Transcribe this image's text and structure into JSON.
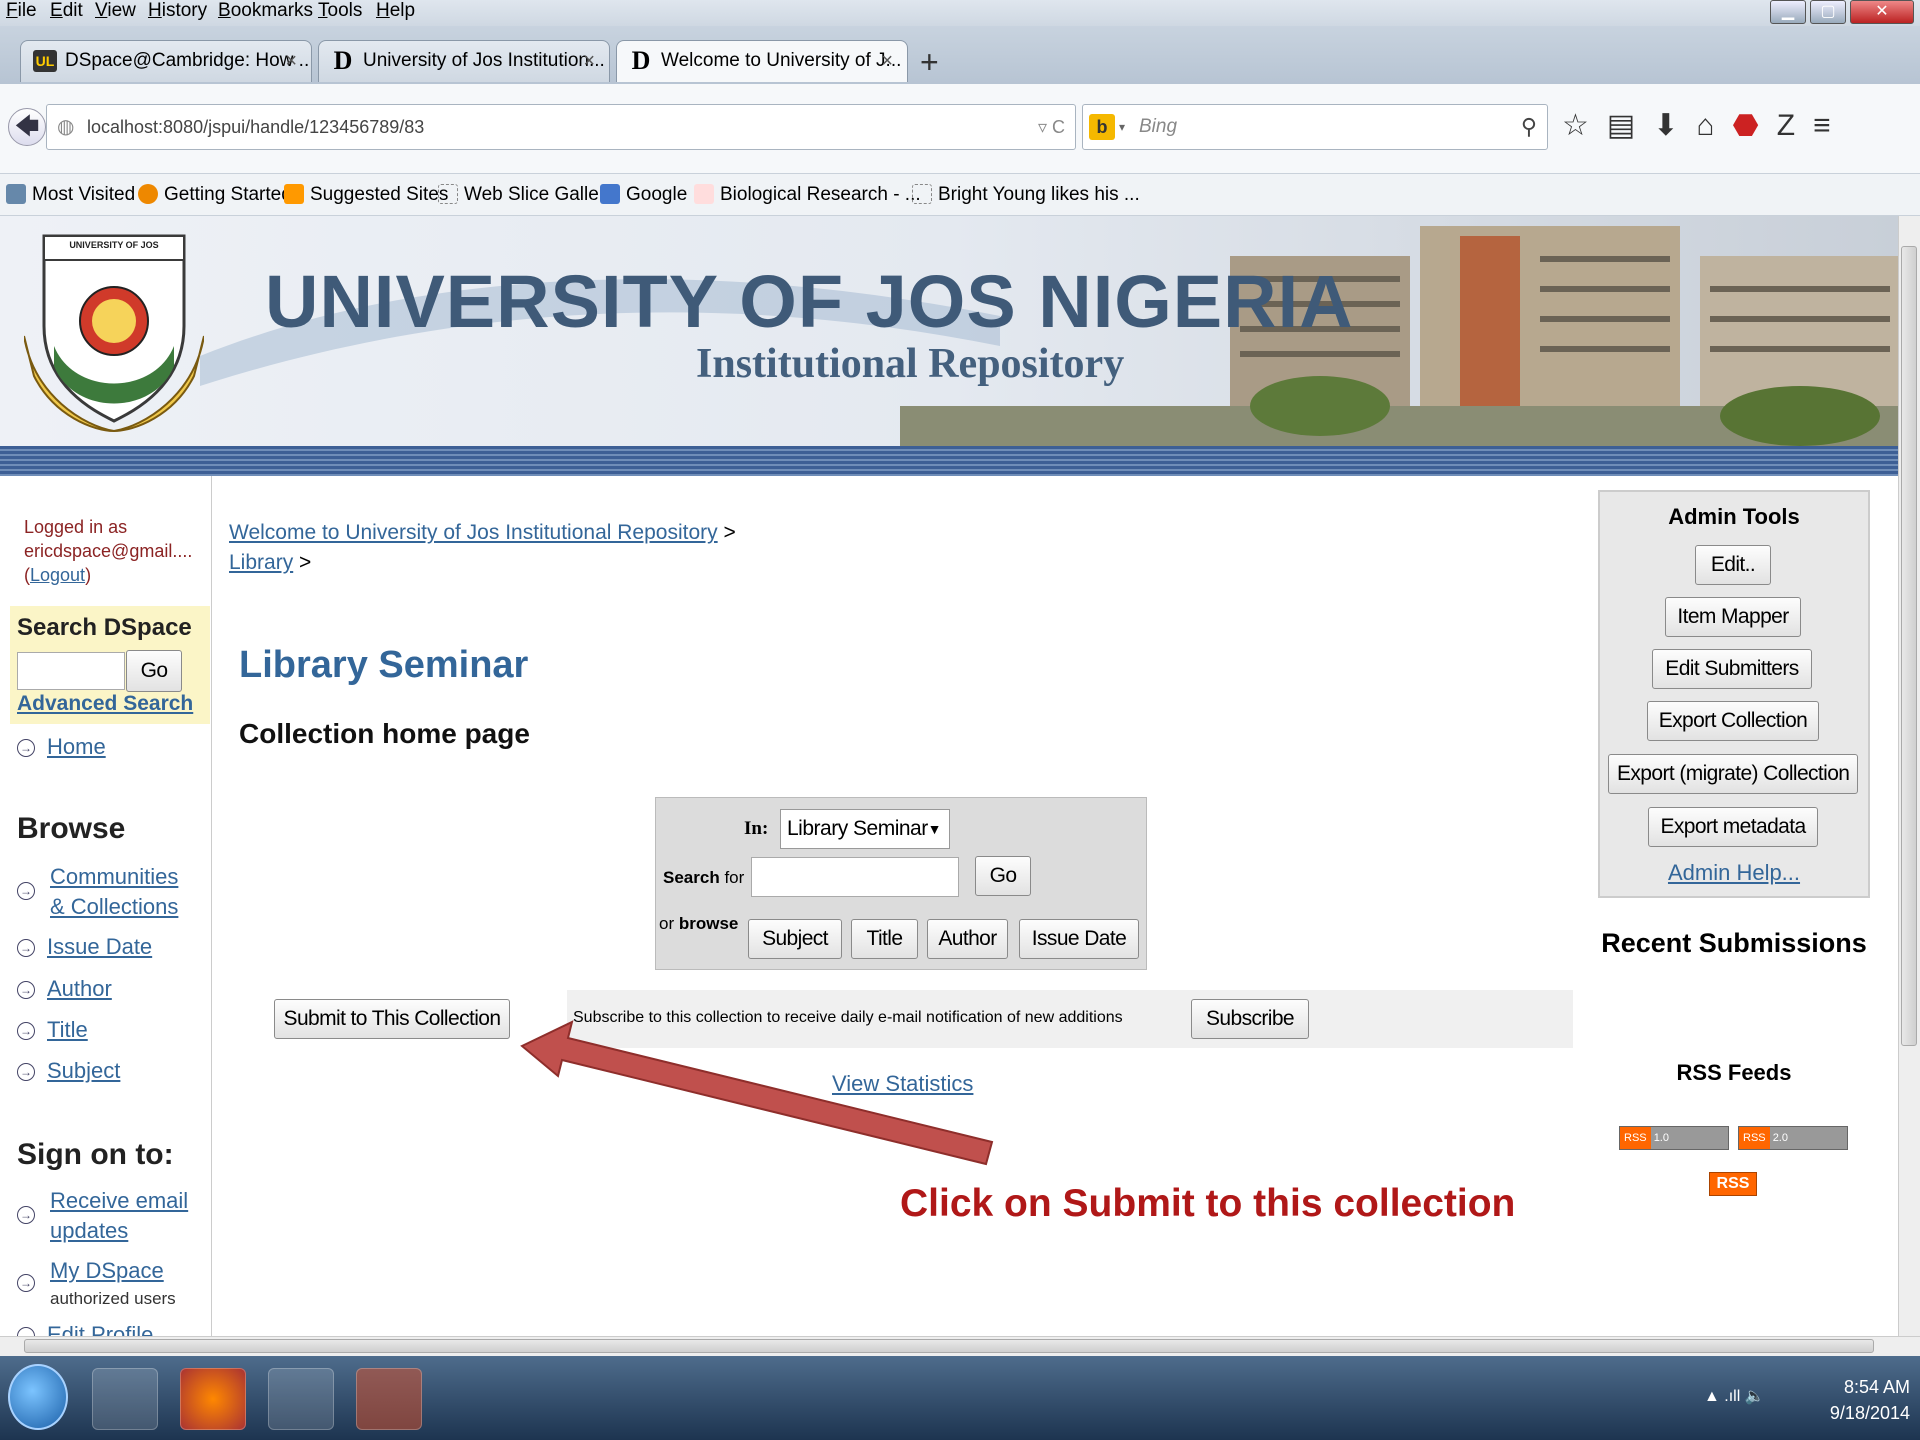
{
  "menu": [
    "File",
    "Edit",
    "View",
    "History",
    "Bookmarks",
    "Tools",
    "Help"
  ],
  "tabs": [
    {
      "icon": "UL",
      "title": "DSpace@Cambridge: How ..."
    },
    {
      "icon": "D",
      "title": "University of Jos Institution..."
    },
    {
      "icon": "D",
      "title": "Welcome to University of J..."
    }
  ],
  "new_tab": "+",
  "url": "localhost:8080/jspui/handle/123456789/83",
  "search_placeholder": "Bing",
  "bookmarks": [
    "Most Visited",
    "Getting Started",
    "Suggested Sites",
    "Web Slice Gallery",
    "Google",
    "Biological Research - ...",
    "Bright Young likes his ..."
  ],
  "banner": {
    "seal_text": "UNIVERSITY OF JOS",
    "title": "UNIVERSITY OF JOS NIGERIA",
    "subtitle": "Institutional Repository"
  },
  "left": {
    "logged_in_label": "Logged in as",
    "user": "ericdspace@gmail....",
    "logout": "Logout",
    "search_heading": "Search DSpace",
    "go": "Go",
    "advanced": "Advanced Search",
    "home": "Home",
    "browse_heading": "Browse",
    "browse_items": [
      "Communities",
      "& Collections",
      "Issue Date",
      "Author",
      "Title",
      "Subject"
    ],
    "signon_heading": "Sign on to:",
    "receive": "Receive email",
    "updates": "updates",
    "mydspace": "My DSpace",
    "authorized": "authorized users",
    "edit_profile": "Edit Profile"
  },
  "breadcrumb": {
    "home": "Welcome to University of Jos Institutional Repository",
    "library": "Library",
    "sep": ">"
  },
  "collection_title": "Library Seminar",
  "collection_sub": "Collection home page",
  "searchform": {
    "in_label": "In:",
    "in_value": "Library Seminar",
    "search_label": "Search",
    "for_label": "for",
    "go": "Go",
    "or_label": "or",
    "browse_label": "browse",
    "browse_buttons": [
      "Subject",
      "Title",
      "Author",
      "Issue Date"
    ]
  },
  "submit_button": "Submit to This Collection",
  "subscribe_text": "Subscribe to this collection to receive daily e-mail notification of new additions",
  "subscribe_button": "Subscribe",
  "view_stats": "View Statistics",
  "annotation": "Click on Submit to this collection",
  "admin": {
    "heading": "Admin Tools",
    "buttons": [
      "Edit..",
      "Item Mapper",
      "Edit Submitters",
      "Export Collection",
      "Export (migrate) Collection",
      "Export metadata"
    ],
    "help": "Admin Help..."
  },
  "recent": "Recent Submissions",
  "rss": {
    "heading": "RSS Feeds",
    "b1_label": "RSS",
    "b1_ver": "1.0",
    "b2_label": "RSS",
    "b2_ver": "2.0",
    "small": "RSS"
  },
  "taskbar": {
    "time": "8:54 AM",
    "date": "9/18/2014"
  },
  "colors": {
    "accent": "#336699",
    "annotation": "#b01818",
    "arrow": "#c0504d"
  }
}
